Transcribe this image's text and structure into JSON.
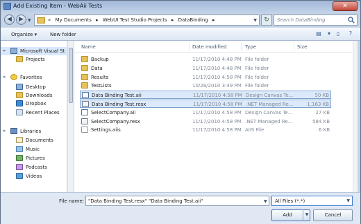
{
  "window": {
    "title": "Add Existing Item - WebAii Tests"
  },
  "address_bar": {
    "prefix": "«",
    "crumbs": [
      "My Documents",
      "WebUI Test Studio Projects",
      "DataBinding"
    ],
    "separator": "▸"
  },
  "search": {
    "placeholder": "Search DataBinding"
  },
  "toolbar": {
    "organize_label": "Organize ▾",
    "new_folder_label": "New folder"
  },
  "nav_pane": {
    "items": [
      {
        "label": "Microsoft Visual St",
        "icon": "computer-icon",
        "level": 0,
        "selected": true
      },
      {
        "label": "Projects",
        "icon": "folder-icon",
        "level": 1,
        "selected": false
      },
      {
        "label": "Favorites",
        "icon": "star-icon",
        "level": 0,
        "selected": false
      },
      {
        "label": "Desktop",
        "icon": "desktop-icon",
        "level": 1,
        "selected": false
      },
      {
        "label": "Downloads",
        "icon": "downloads-icon",
        "level": 1,
        "selected": false
      },
      {
        "label": "Dropbox",
        "icon": "dropbox-icon",
        "level": 1,
        "selected": false
      },
      {
        "label": "Recent Places",
        "icon": "recent-places-icon",
        "level": 1,
        "selected": false
      },
      {
        "label": "Libraries",
        "icon": "libraries-icon",
        "level": 0,
        "selected": false
      },
      {
        "label": "Documents",
        "icon": "documents-icon",
        "level": 1,
        "selected": false
      },
      {
        "label": "Music",
        "icon": "music-icon",
        "level": 1,
        "selected": false
      },
      {
        "label": "Pictures",
        "icon": "pictures-icon",
        "level": 1,
        "selected": false
      },
      {
        "label": "Podcasts",
        "icon": "podcasts-icon",
        "level": 1,
        "selected": false
      },
      {
        "label": "Videos",
        "icon": "videos-icon",
        "level": 1,
        "selected": false
      }
    ]
  },
  "file_list": {
    "columns": {
      "name": "Name",
      "date": "Date modified",
      "type": "Type",
      "size": "Size"
    },
    "rows": [
      {
        "name": "Backup",
        "date": "11/17/2010 4:48 PM",
        "type": "File folder",
        "size": "",
        "icon": "folder-icon",
        "selected": false
      },
      {
        "name": "Data",
        "date": "11/17/2010 4:48 PM",
        "type": "File folder",
        "size": "",
        "icon": "folder-icon",
        "selected": false
      },
      {
        "name": "Results",
        "date": "11/17/2010 4:58 PM",
        "type": "File folder",
        "size": "",
        "icon": "folder-icon",
        "selected": false
      },
      {
        "name": "TestLists",
        "date": "10/28/2010 3:49 PM",
        "type": "File folder",
        "size": "",
        "icon": "folder-icon",
        "selected": false
      },
      {
        "name": "Data Binding Test.aii",
        "date": "11/17/2010 4:58 PM",
        "type": "Design Canvas Te...",
        "size": "50 KB",
        "icon": "test-file-icon",
        "selected": true
      },
      {
        "name": "Data Binding Test.resx",
        "date": "11/17/2010 4:58 PM",
        "type": ".NET Managed Re...",
        "size": "1,163 KB",
        "icon": "resx-file-icon",
        "selected": true
      },
      {
        "name": "SelectCompany.aii",
        "date": "11/17/2010 4:58 PM",
        "type": "Design Canvas Te...",
        "size": "27 KB",
        "icon": "test-file-icon",
        "selected": false
      },
      {
        "name": "SelectCompany.resx",
        "date": "11/17/2010 4:58 PM",
        "type": ".NET Managed Re...",
        "size": "584 KB",
        "icon": "resx-file-icon",
        "selected": false
      },
      {
        "name": "Settings.aiis",
        "date": "11/17/2010 4:58 PM",
        "type": "AIIS File",
        "size": "6 KB",
        "icon": "settings-file-icon",
        "selected": false
      }
    ]
  },
  "footer": {
    "file_name_label": "File name:",
    "file_name_value": "\"Data Binding Test.resx\" \"Data Binding Test.aii\"",
    "file_type_value": "All Files (*.*)",
    "add_label": "Add",
    "cancel_label": "Cancel"
  },
  "colors": {
    "chrome": "#c4d3e6",
    "selection": "#dce9fa",
    "selection_border": "#7da2ce"
  }
}
